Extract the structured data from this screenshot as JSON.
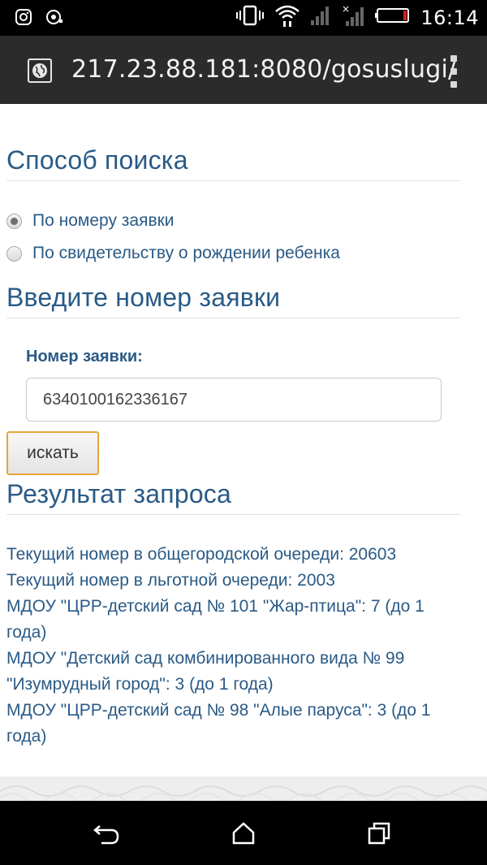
{
  "status_bar": {
    "time": "16:14",
    "icons": [
      "instagram-icon",
      "notification-icon",
      "vibrate-icon",
      "wifi-icon",
      "signal-icon",
      "no-signal-icon",
      "battery-icon"
    ]
  },
  "browser": {
    "url": "217.23.88.181:8080/gosuslugi/",
    "site_icon": "globe-icon",
    "menu_icon": "more-vert-icon"
  },
  "search_method": {
    "title": "Способ поиска",
    "options": [
      {
        "label": "По номеру заявки",
        "checked": true
      },
      {
        "label": "По свидетельству о рождении ребенка",
        "checked": false
      }
    ]
  },
  "enter_number": {
    "title": "Введите номер заявки",
    "field_label": "Номер заявки:",
    "field_value": "6340100162336167",
    "search_button": "искать"
  },
  "result": {
    "title": "Результат запроса",
    "lines": [
      "Текущий номер в общегородской очереди: 20603",
      "Текущий номер в льготной очереди: 2003",
      "МДОУ \"ЦРР-детский сад № 101 \"Жар-птица\": 7 (до 1",
      "года)",
      "МДОУ \"Детский сад комбинированного вида № 99",
      "\"Изумрудный город\": 3 (до 1 года)",
      "МДОУ \"ЦРР-детский сад № 98 \"Алые паруса\": 3 (до 1",
      "года)"
    ]
  },
  "nav_bar": {
    "icons": [
      "back-icon",
      "home-icon",
      "recents-icon"
    ]
  },
  "colors": {
    "heading": "#2a5a86",
    "status_bar": "#000000",
    "address_bar": "#2b2b2b",
    "button_border": "#e6a63a"
  }
}
